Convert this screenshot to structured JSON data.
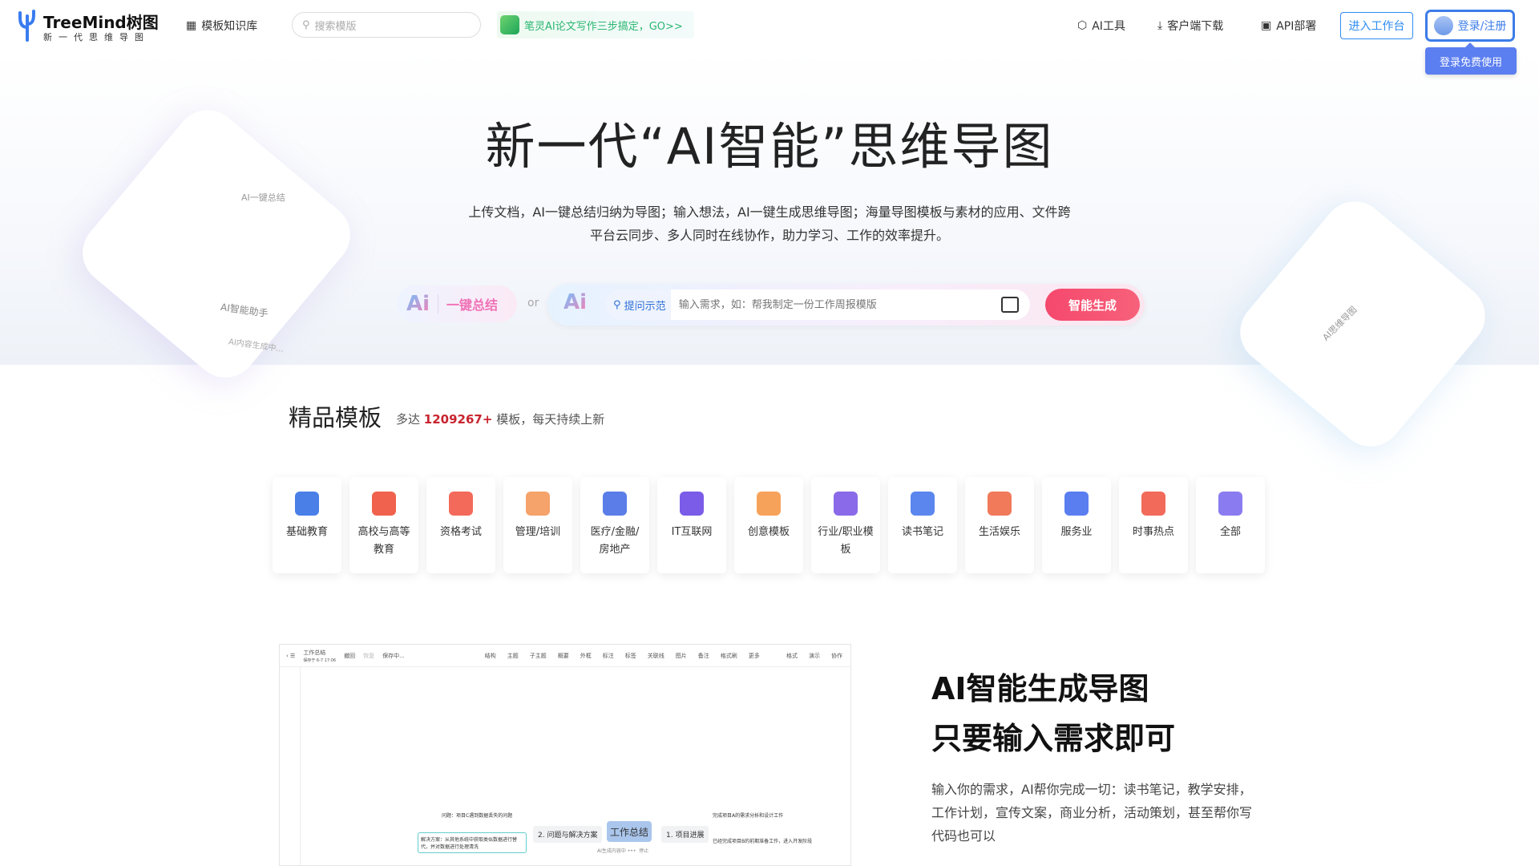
{
  "nav": {
    "brand": "TreeMind树图",
    "slogan": "新一代思维导图",
    "template_lib": "模板知识库",
    "search_placeholder": "搜索模版",
    "promo": "笔灵AI论文写作三步搞定，GO>>",
    "ai_tools": "AI工具",
    "download": "客户端下载",
    "api": "API部署",
    "workspace": "进入工作台",
    "login": "登录/注册",
    "login_tip": "登录免费使用"
  },
  "hero": {
    "title": "新一代“AI智能”思维导图",
    "desc": "上传文档，AI一键总结归纳为导图；输入想法，AI一键生成思维导图；海量导图模板与素材的应用、文件跨平台云同步、多人同时在线协作，助力学习、工作的效率提升。",
    "ai_logo": "Ai",
    "summary": "一键总结",
    "or": "or",
    "example": "提问示范",
    "input_placeholder": "输入需求，如：帮我制定一份工作周报模版",
    "generate": "智能生成",
    "deco_left_1": "AI一键总结",
    "deco_left_2": "AI智能助手",
    "deco_left_3": "AI内容生成中...",
    "deco_right": "AI思维导图"
  },
  "templates": {
    "title": "精品模板",
    "sub_pre": "多达",
    "count": "1209267+",
    "sub_post": "模板，每天持续上新",
    "categories": [
      {
        "label": "基础教育",
        "color": "#4a7fe8"
      },
      {
        "label": "高校与高等教育",
        "color": "#f0624d"
      },
      {
        "label": "资格考试",
        "color": "#f36a5a"
      },
      {
        "label": "管理/培训",
        "color": "#f5a26b"
      },
      {
        "label": "医疗/金融/房地产",
        "color": "#5a7de8"
      },
      {
        "label": "IT互联网",
        "color": "#7a5ce8"
      },
      {
        "label": "创意模板",
        "color": "#f7a25a"
      },
      {
        "label": "行业/职业模板",
        "color": "#8a6ae8"
      },
      {
        "label": "读书笔记",
        "color": "#5a86ee"
      },
      {
        "label": "生活娱乐",
        "color": "#f07a5a"
      },
      {
        "label": "服务业",
        "color": "#5a7ef0"
      },
      {
        "label": "时事热点",
        "color": "#f26a5a"
      },
      {
        "label": "全部",
        "color": "#8a7cf0"
      }
    ]
  },
  "editor": {
    "doc": "工作总结",
    "saved": "保存于 6-7 17:06",
    "undo": "撤回",
    "redo": "恢复",
    "saving": "保存中...",
    "tools": [
      "结构",
      "主题",
      "子主题",
      "概要",
      "外框",
      "标注",
      "标签",
      "关联线",
      "图片",
      "备注",
      "格式刷",
      "更多"
    ],
    "right_tools": [
      "格式",
      "演示",
      "协作"
    ],
    "center": "工作总结",
    "b1": "1. 项目进展",
    "b2": "2. 问题与解决方案",
    "l1": "完成项目A的需求分析和设计工作",
    "l2": "已经完成项目B的前期准备工作，进入开发阶段",
    "l3": "问题：项目C遇到数据丢失的问题",
    "l4": "解决方案：从其他系统中获取类似数据进行替代，并对数据进行处理清洗",
    "status": "AI生成内容中",
    "stop": "停止"
  },
  "feature": {
    "h1": "AI智能生成导图",
    "h2": "只要输入需求即可",
    "desc": "输入你的需求，AI帮你完成一切：读书笔记，教学安排，工作计划，宣传文案，商业分析，活动策划，甚至帮你写代码也可以"
  }
}
